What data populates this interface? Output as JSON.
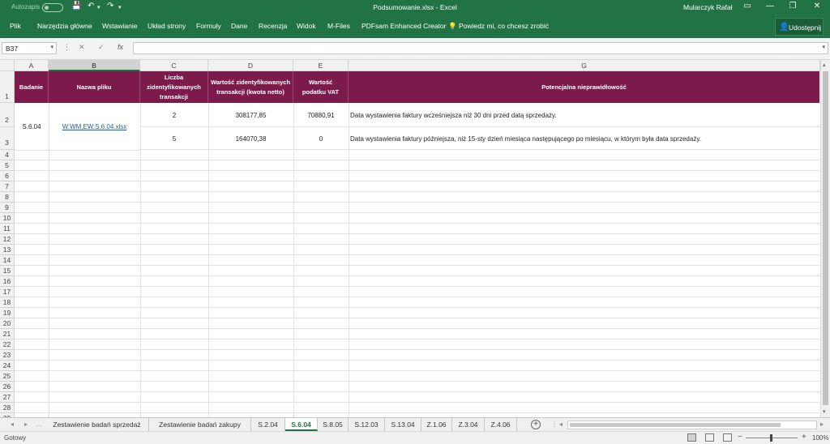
{
  "titlebar": {
    "autosave": "Autozapis",
    "doc_title": "Podsumowanie.xlsx  -  Excel",
    "user": "Mularczyk Rafał",
    "save_glyph": "💾",
    "undo_glyph": "↶",
    "redo_glyph": "↷",
    "more_glyph": "▾",
    "ribbon_glyph": "▭",
    "min_glyph": "—",
    "max_glyph": "❐",
    "close_glyph": "✕"
  },
  "ribbon": {
    "tabs": [
      "Plik",
      "Narzędzia główne",
      "Wstawianie",
      "Układ strony",
      "Formuły",
      "Dane",
      "Recenzja",
      "Widok",
      "M-Files",
      "PDFsam Enhanced Creator"
    ],
    "tellme": "Powiedz mi, co chcesz zrobić",
    "share": "Udostępnij",
    "bulb_glyph": "💡",
    "person_glyph": "👤"
  },
  "formula_bar": {
    "name_box": "B37",
    "dropdown_glyph": "▾",
    "dots_glyph": "⋮",
    "cancel_glyph": "✕",
    "enter_glyph": "✓",
    "fx_glyph": "fx",
    "formula": ""
  },
  "columns": [
    "A",
    "B",
    "C",
    "D",
    "E",
    "F",
    "G"
  ],
  "header_row": {
    "a": "Badanie",
    "b": "Nazwa pliku",
    "c": "Liczba zidentyfikowanych transakcji",
    "d": "Wartość zidentyfikowanych transakcji  (kwota netto)",
    "e": "Wartość podatku VAT",
    "g": "Potencjalna nieprawidłowość"
  },
  "data": {
    "badanie": "S.6.04",
    "plik": "W.WM.EW.S.6.04.xlsx",
    "rows": [
      {
        "liczba": "2",
        "wartosc": "308177,85",
        "vat": "70880,91",
        "opis": "Data wystawienia faktury wcześniejsza niż 30 dni przed datą sprzedaży."
      },
      {
        "liczba": "5",
        "wartosc": "164070,38",
        "vat": "0",
        "opis": "Data wystawienia faktury późniejsza, niż 15-sty dzień miesiąca następującego po miesiącu, w którym była data sprzedaży."
      }
    ]
  },
  "row_numbers": [
    "1",
    "2",
    "3",
    "4",
    "5",
    "6",
    "7",
    "8",
    "9",
    "10",
    "11",
    "12",
    "13",
    "14",
    "15",
    "16",
    "17",
    "18",
    "19",
    "20",
    "21",
    "22",
    "23",
    "24",
    "25",
    "26",
    "27",
    "28",
    "29"
  ],
  "sheets": {
    "nav_prev": "◂",
    "nav_next": "▸",
    "nav_more": "…",
    "add": "+",
    "tabs": [
      "Zestawienie badań sprzedaż",
      "Zestawienie badań zakupy",
      "S.2.04",
      "S.6.04",
      "S.8.05",
      "S.12.03",
      "S.13.04",
      "Z.1.06",
      "Z.3.04",
      "Z.4.06"
    ],
    "active": "S.6.04"
  },
  "scrollbar": {
    "up": "▴",
    "down": "▾",
    "left": "◂",
    "right": "▸"
  },
  "status": {
    "ready": "Gotowy",
    "zoom": "100%",
    "zoom_minus": "−",
    "zoom_plus": "+"
  },
  "colors": {
    "accent": "#217346",
    "header_fill": "#7b1a4b",
    "link": "#1f5fa5"
  }
}
